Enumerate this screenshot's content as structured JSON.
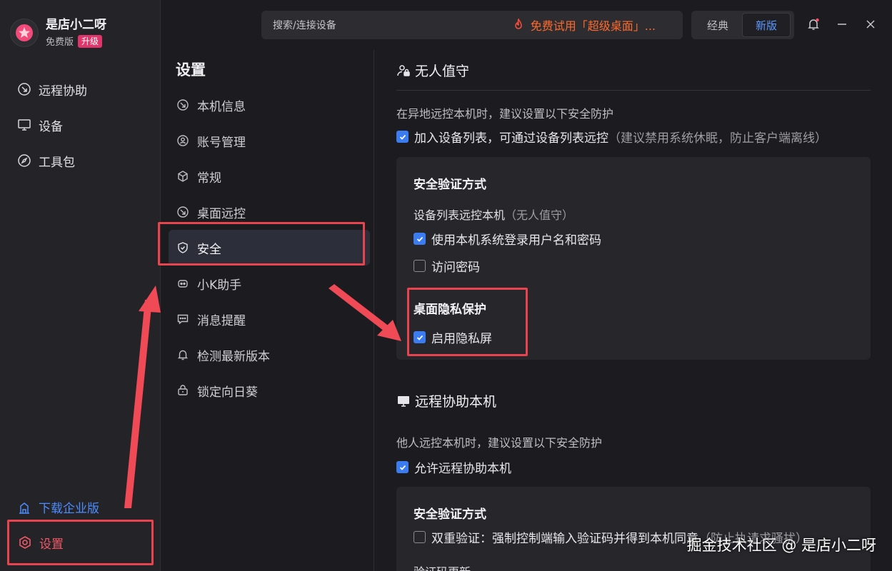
{
  "app": {
    "user_name": "是店小二呀",
    "plan": "免费版",
    "upgrade_label": "升级"
  },
  "nav": {
    "items": [
      {
        "label": "远程协助",
        "icon": "remote-assist-icon"
      },
      {
        "label": "设备",
        "icon": "monitor-icon"
      },
      {
        "label": "工具包",
        "icon": "compass-icon"
      }
    ],
    "download_enterprise": "下载企业版",
    "settings": "设置"
  },
  "topbar": {
    "search_placeholder": "搜索/连接设备",
    "promo": "免费试用「超级桌面」...",
    "mode_classic": "经典",
    "mode_new": "新版"
  },
  "subnav": {
    "title": "设置",
    "items": [
      {
        "label": "本机信息",
        "icon": "device-info-icon"
      },
      {
        "label": "账号管理",
        "icon": "account-icon"
      },
      {
        "label": "常规",
        "icon": "cube-icon"
      },
      {
        "label": "桌面远控",
        "icon": "remote-control-icon"
      },
      {
        "label": "安全",
        "icon": "shield-icon",
        "active": true
      },
      {
        "label": "小K助手",
        "icon": "robot-icon"
      },
      {
        "label": "消息提醒",
        "icon": "message-icon"
      },
      {
        "label": "检测最新版本",
        "icon": "bell-icon"
      },
      {
        "label": "锁定向日葵",
        "icon": "lock-icon"
      }
    ]
  },
  "unattended": {
    "title": "无人值守",
    "hint": "在异地远控本机时，建议设置以下安全防护",
    "add_to_list": "加入设备列表，可通过设备列表远控",
    "add_to_list_note": "（建议禁用系统休眠，防止客户端离线）",
    "card": {
      "auth_title": "安全验证方式",
      "list_control": "设备列表远控本机",
      "list_control_note": "（无人值守）",
      "use_system_login": "使用本机系统登录用户名和密码",
      "access_password": "访问密码",
      "privacy_title": "桌面隐私保护",
      "enable_privacy": "启用隐私屏"
    }
  },
  "remote_assist": {
    "title": "远程协助本机",
    "hint": "他人远控本机时，建议设置以下安全防护",
    "allow": "允许远程协助本机",
    "card": {
      "auth_title": "安全验证方式",
      "two_factor": "双重验证：强制控制端输入验证码并得到本机同意",
      "two_factor_note": "（防止执请求骚扰）",
      "code_update": "验证码更新"
    }
  },
  "watermark": "掘金技术社区 @ 是店小二呀",
  "colors": {
    "accent_blue": "#3b7cf0",
    "highlight_red": "#e8434e",
    "promo_orange": "#ff6a2d",
    "badge_pink": "#e0356b"
  }
}
